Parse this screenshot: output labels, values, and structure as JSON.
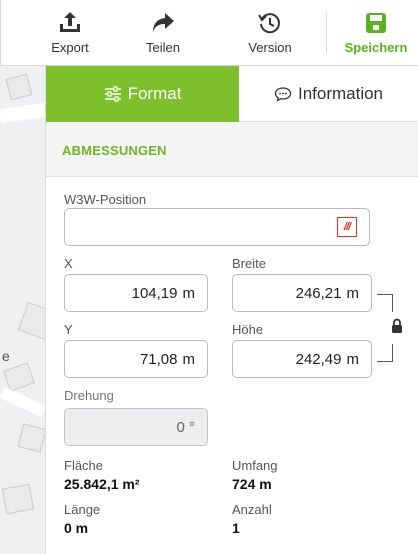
{
  "toolbar": {
    "export_label": "Export",
    "share_label": "Teilen",
    "version_label": "Version",
    "save_label": "Speichern"
  },
  "map": {
    "edge_label": "e"
  },
  "tabs": [
    {
      "label": "Format",
      "icon": "sliders-icon",
      "active": true
    },
    {
      "label": "Information",
      "icon": "speech-bubble-icon",
      "active": false
    }
  ],
  "section": {
    "title": "ABMESSUNGEN"
  },
  "fields": {
    "w3w": {
      "label": "W3W-Position",
      "value": "",
      "icon_text": "///"
    },
    "x": {
      "label": "X",
      "value": "104,19",
      "unit": "m"
    },
    "y": {
      "label": "Y",
      "value": "71,08",
      "unit": "m"
    },
    "width": {
      "label": "Breite",
      "value": "246,21",
      "unit": "m"
    },
    "height": {
      "label": "Höhe",
      "value": "242,49",
      "unit": "m"
    },
    "rotation": {
      "label": "Drehung",
      "value": "0 °"
    }
  },
  "stats": {
    "area": {
      "label": "Fläche",
      "value": "25.842,1 m²"
    },
    "perimeter": {
      "label": "Umfang",
      "value": "724 m"
    },
    "length": {
      "label": "Länge",
      "value": "0 m"
    },
    "count": {
      "label": "Anzahl",
      "value": "1"
    }
  },
  "colors": {
    "accent": "#7ec02c",
    "save": "#5ab41e",
    "w3w": "#e0312b"
  }
}
